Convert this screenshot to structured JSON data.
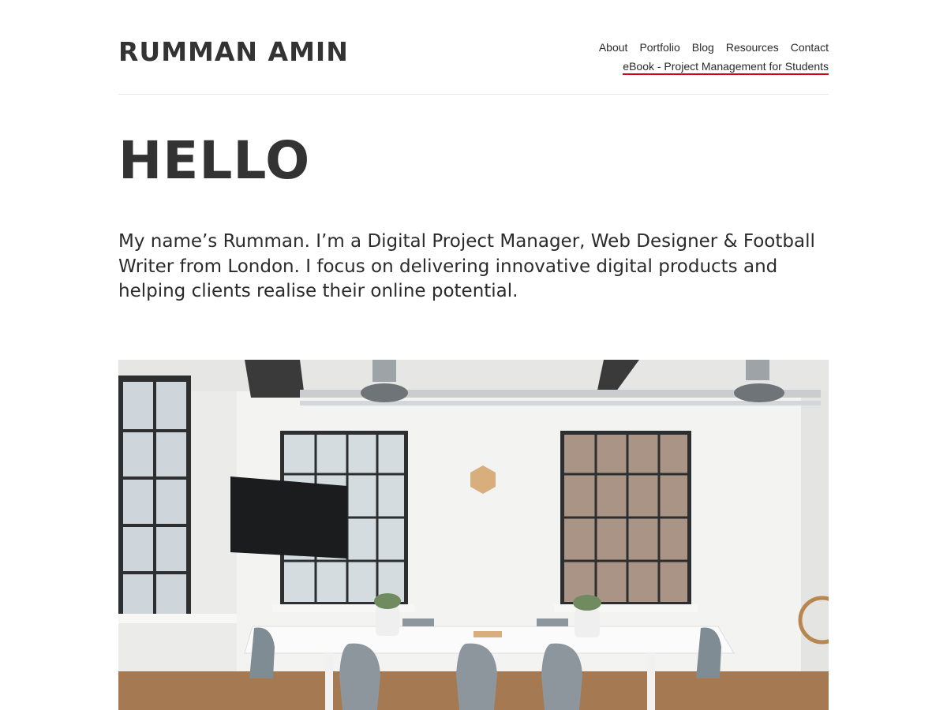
{
  "header": {
    "site_title": "RUMMAN AMIN",
    "nav": [
      {
        "label": "About"
      },
      {
        "label": "Portfolio"
      },
      {
        "label": "Blog"
      },
      {
        "label": "Resources"
      },
      {
        "label": "Contact"
      }
    ],
    "secondary_nav": {
      "label": "eBook - Project Management for Students"
    }
  },
  "main": {
    "heading": "HELLO",
    "intro": "My name’s Rumman. I’m a Digital Project Manager, Web Designer & Football Writer from London. I focus on delivering innovative digital products and helping clients realise their online potential.",
    "hero_image": {
      "subject": "office-meeting-room-photo"
    }
  },
  "colors": {
    "text": "#2b2b2b",
    "accent_underline": "#d0021b",
    "divider": "#e8e8e8"
  }
}
